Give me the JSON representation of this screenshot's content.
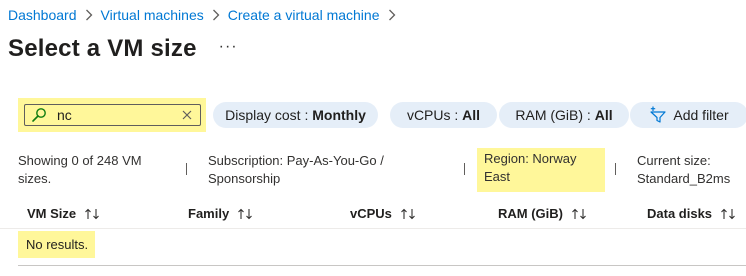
{
  "breadcrumb": {
    "items": [
      {
        "label": "Dashboard"
      },
      {
        "label": "Virtual machines"
      },
      {
        "label": "Create a virtual machine"
      }
    ],
    "separator_icon": "chevron-right-icon"
  },
  "page": {
    "title": "Select a VM size",
    "more_label": "···"
  },
  "search": {
    "value": "nc",
    "placeholder": "",
    "icon": "search-icon",
    "clear_icon": "close-icon"
  },
  "filters": {
    "cost": {
      "label": "Display cost : ",
      "value": "Monthly"
    },
    "vcpus": {
      "label": "vCPUs : ",
      "value": "All"
    },
    "ram": {
      "label": "RAM (GiB) : ",
      "value": "All"
    },
    "add_filter": {
      "label": "Add filter",
      "icon": "add-filter-icon"
    }
  },
  "info": {
    "count_text": "Showing 0 of 248 VM sizes.",
    "subscription_text": "Subscription: Pay-As-You-Go / Sponsorship",
    "region_text": "Region: Norway East",
    "current_size_text": "Current size: Standard_B2ms"
  },
  "table": {
    "columns": [
      {
        "label": "VM Size"
      },
      {
        "label": "Family"
      },
      {
        "label": "vCPUs"
      },
      {
        "label": "RAM (GiB)"
      },
      {
        "label": "Data disks"
      }
    ],
    "sort_icon": "sort-icon",
    "empty_text": "No results."
  },
  "colors": {
    "link": "#0078d4",
    "highlight": "#fff79a",
    "pill_background": "#e5eef8",
    "text": "#323130"
  }
}
